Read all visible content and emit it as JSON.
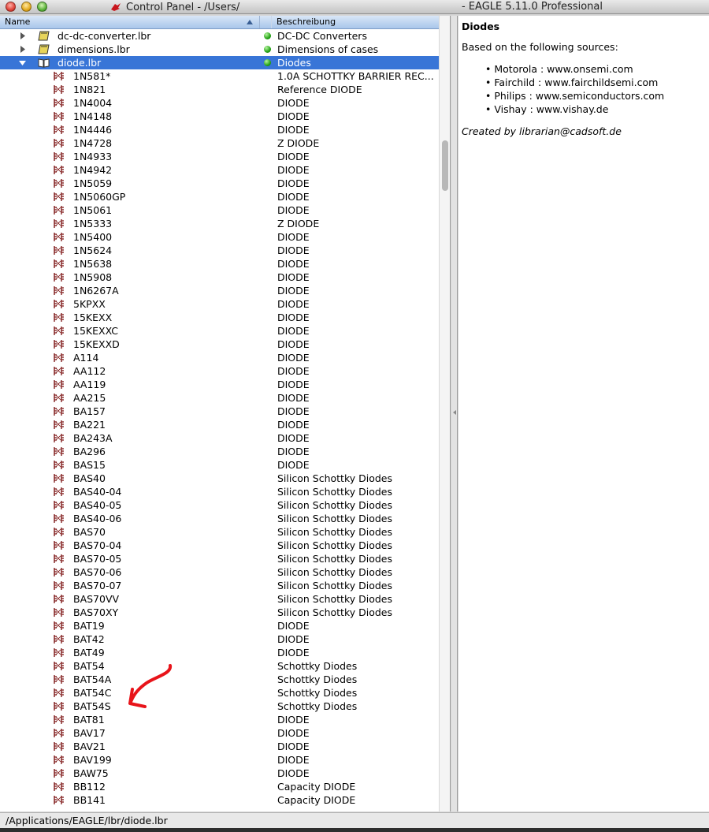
{
  "window": {
    "title_left": "Control Panel - /Users/",
    "title_right": "- EAGLE 5.11.0 Professional"
  },
  "tree": {
    "columns": {
      "name": "Name",
      "description": "Beschreibung"
    },
    "libraries": [
      {
        "name": "dc-dc-converter.lbr",
        "desc": "DC-DC Converters",
        "expanded": false,
        "selected": false
      },
      {
        "name": "dimensions.lbr",
        "desc": "Dimensions of cases",
        "expanded": false,
        "selected": false
      },
      {
        "name": "diode.lbr",
        "desc": "Diodes",
        "expanded": true,
        "selected": true
      }
    ],
    "devices": [
      {
        "name": "1N581*",
        "desc": "1.0A SCHOTTKY BARRIER REC..."
      },
      {
        "name": "1N821",
        "desc": "Reference DIODE"
      },
      {
        "name": "1N4004",
        "desc": "DIODE"
      },
      {
        "name": "1N4148",
        "desc": "DIODE"
      },
      {
        "name": "1N4446",
        "desc": "DIODE"
      },
      {
        "name": "1N4728",
        "desc": "Z DIODE"
      },
      {
        "name": "1N4933",
        "desc": "DIODE"
      },
      {
        "name": "1N4942",
        "desc": "DIODE"
      },
      {
        "name": "1N5059",
        "desc": "DIODE"
      },
      {
        "name": "1N5060GP",
        "desc": "DIODE"
      },
      {
        "name": "1N5061",
        "desc": "DIODE"
      },
      {
        "name": "1N5333",
        "desc": "Z DIODE"
      },
      {
        "name": "1N5400",
        "desc": "DIODE"
      },
      {
        "name": "1N5624",
        "desc": "DIODE"
      },
      {
        "name": "1N5638",
        "desc": "DIODE"
      },
      {
        "name": "1N5908",
        "desc": "DIODE"
      },
      {
        "name": "1N6267A",
        "desc": "DIODE"
      },
      {
        "name": "5KPXX",
        "desc": "DIODE"
      },
      {
        "name": "15KEXX",
        "desc": "DIODE"
      },
      {
        "name": "15KEXXC",
        "desc": "DIODE"
      },
      {
        "name": "15KEXXD",
        "desc": "DIODE"
      },
      {
        "name": "A114",
        "desc": "DIODE"
      },
      {
        "name": "AA112",
        "desc": "DIODE"
      },
      {
        "name": "AA119",
        "desc": "DIODE"
      },
      {
        "name": "AA215",
        "desc": "DIODE"
      },
      {
        "name": "BA157",
        "desc": "DIODE"
      },
      {
        "name": "BA221",
        "desc": "DIODE"
      },
      {
        "name": "BA243A",
        "desc": "DIODE"
      },
      {
        "name": "BA296",
        "desc": "DIODE"
      },
      {
        "name": "BAS15",
        "desc": "DIODE"
      },
      {
        "name": "BAS40",
        "desc": "Silicon Schottky Diodes"
      },
      {
        "name": "BAS40-04",
        "desc": "Silicon Schottky Diodes"
      },
      {
        "name": "BAS40-05",
        "desc": "Silicon Schottky Diodes"
      },
      {
        "name": "BAS40-06",
        "desc": "Silicon Schottky Diodes"
      },
      {
        "name": "BAS70",
        "desc": "Silicon Schottky Diodes"
      },
      {
        "name": "BAS70-04",
        "desc": "Silicon Schottky Diodes"
      },
      {
        "name": "BAS70-05",
        "desc": "Silicon Schottky Diodes"
      },
      {
        "name": "BAS70-06",
        "desc": "Silicon Schottky Diodes"
      },
      {
        "name": "BAS70-07",
        "desc": "Silicon Schottky Diodes"
      },
      {
        "name": "BAS70VV",
        "desc": "Silicon Schottky Diodes"
      },
      {
        "name": "BAS70XY",
        "desc": "Silicon Schottky Diodes"
      },
      {
        "name": "BAT19",
        "desc": "DIODE"
      },
      {
        "name": "BAT42",
        "desc": "DIODE"
      },
      {
        "name": "BAT49",
        "desc": "DIODE"
      },
      {
        "name": "BAT54",
        "desc": "Schottky Diodes"
      },
      {
        "name": "BAT54A",
        "desc": "Schottky Diodes"
      },
      {
        "name": "BAT54C",
        "desc": "Schottky Diodes"
      },
      {
        "name": "BAT54S",
        "desc": "Schottky Diodes"
      },
      {
        "name": "BAT81",
        "desc": "DIODE"
      },
      {
        "name": "BAV17",
        "desc": "DIODE"
      },
      {
        "name": "BAV21",
        "desc": "DIODE"
      },
      {
        "name": "BAV199",
        "desc": "DIODE"
      },
      {
        "name": "BAW75",
        "desc": "DIODE"
      },
      {
        "name": "BB112",
        "desc": "Capacity DIODE"
      },
      {
        "name": "BB141",
        "desc": "Capacity DIODE"
      }
    ]
  },
  "info": {
    "title": "Diodes",
    "text": "Based on the following sources:",
    "sources": [
      "Motorola : www.onsemi.com",
      "Fairchild : www.fairchildsemi.com",
      "Philips : www.semiconductors.com",
      "Vishay : www.vishay.de"
    ],
    "created": "Created by librarian@cadsoft.de"
  },
  "status": {
    "path": "/Applications/EAGLE/lbr/diode.lbr"
  },
  "colors": {
    "selection": "#3875d7",
    "annotation": "#e8141a",
    "status_dot": "#25a316"
  }
}
